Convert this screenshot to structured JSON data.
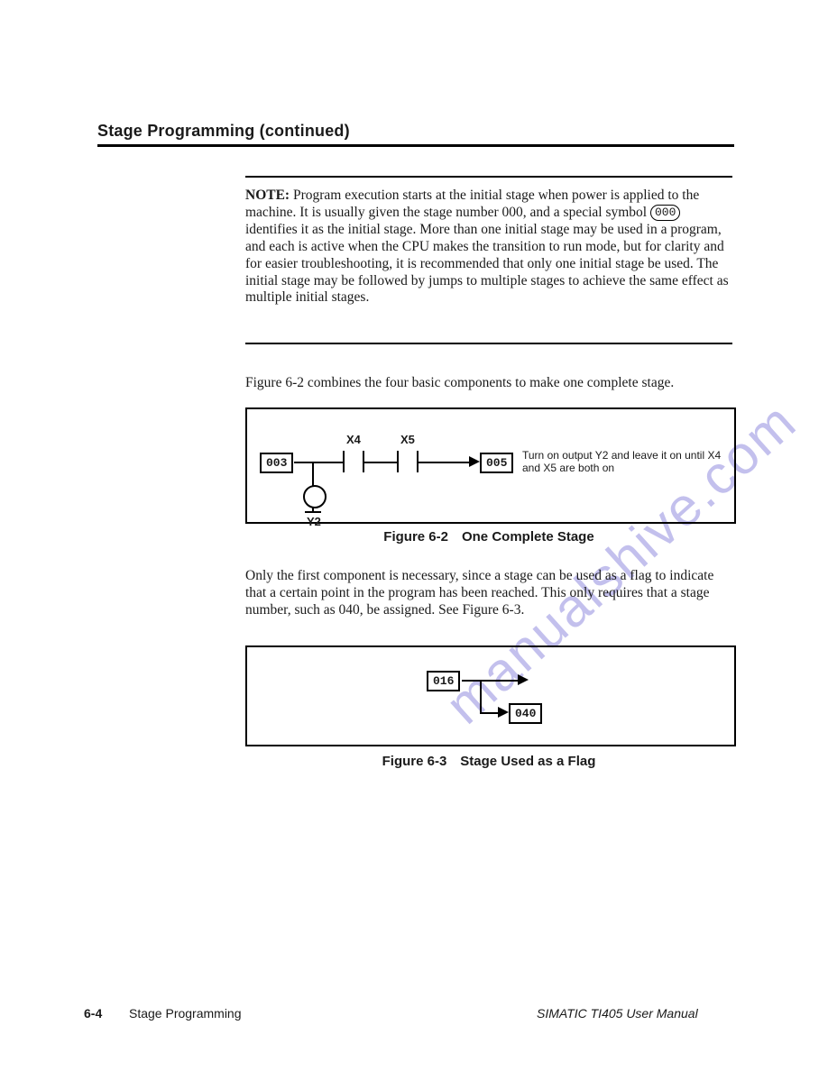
{
  "heading": "Stage Programming (continued)",
  "note": {
    "lead": "NOTE:",
    "pre_symbol": "Program execution starts at the initial stage when power is applied to the machine. It is usually given the stage number 000, and a special symbol ",
    "symbol": "000",
    "post_symbol": " identifies it as the initial stage. More than one initial stage may be used in a program, and each is active when the CPU makes the transition to run mode, but for clarity and for easier troubleshooting, it is recommended that only one initial stage be used. The initial stage may be followed by jumps to multiple stages to achieve the same effect as multiple initial stages."
  },
  "fig62_intro": "Figure 6-2 combines the four basic components to make one complete stage.",
  "fig62": {
    "stage_from": "003",
    "contact1": "X4",
    "contact2": "X5",
    "stage_to": "005",
    "output_label": "Y2",
    "side_text": "Turn on output Y2 and leave it on until X4 and X5 are both on"
  },
  "fig62_caption": "Figure 6-2 One Complete Stage",
  "mid_para": "Only the first component is necessary, since a stage can be used as a flag to indicate that a certain point in the program has been reached. This only requires that a stage number, such as 040, be assigned. See Figure 6-3.",
  "fig63": {
    "stage_from": "016",
    "stage_to": "040"
  },
  "fig63_caption": "Figure 6-3 Stage Used as a Flag",
  "footer": {
    "page_number": "6-4",
    "chapter": "Stage Programming",
    "manual": "SIMATIC TI405 User Manual"
  },
  "watermark": "manualshive.com"
}
